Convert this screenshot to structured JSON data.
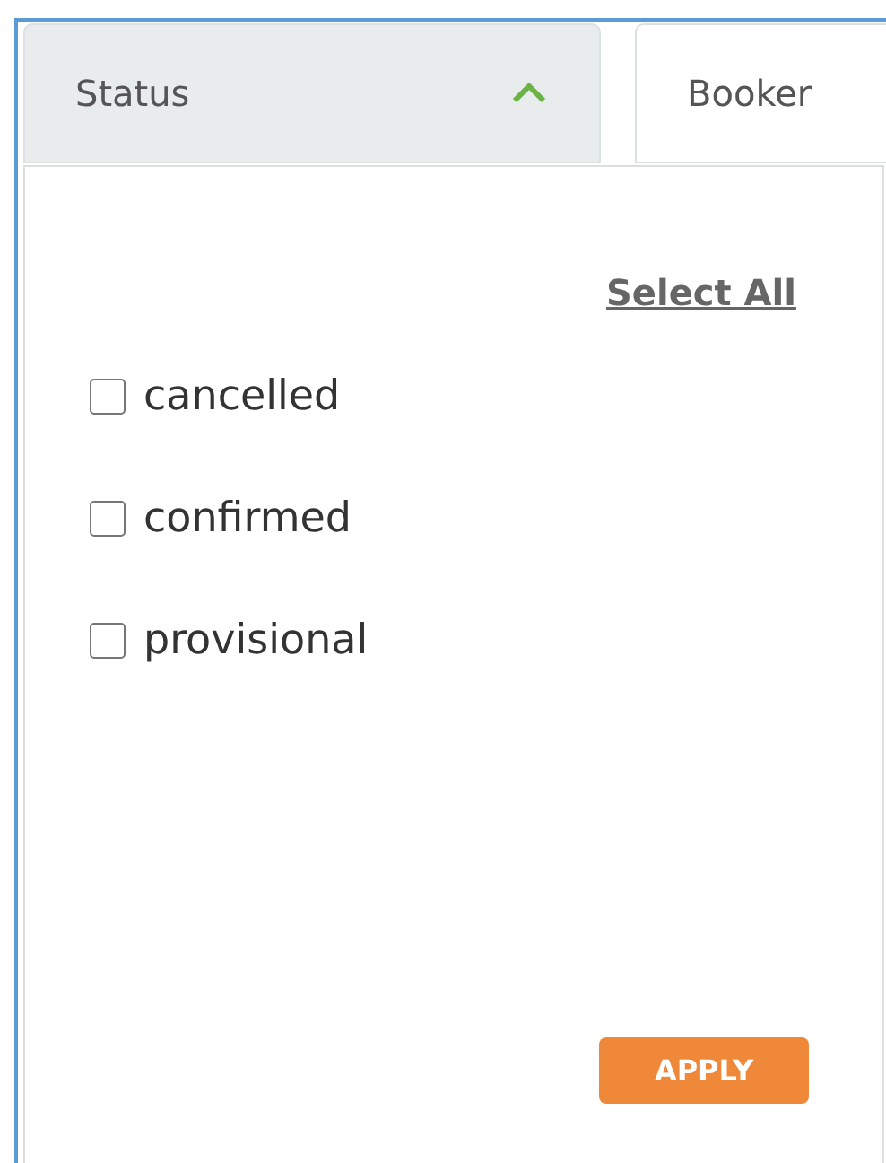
{
  "filters": [
    {
      "label": "Status",
      "expanded": true
    },
    {
      "label": "Booker",
      "expanded": false
    }
  ],
  "dropdown": {
    "select_all": "Select All",
    "options": [
      {
        "label": "cancelled",
        "checked": false
      },
      {
        "label": "confirmed",
        "checked": false
      },
      {
        "label": "provisional",
        "checked": false
      }
    ],
    "apply": "APPLY"
  }
}
